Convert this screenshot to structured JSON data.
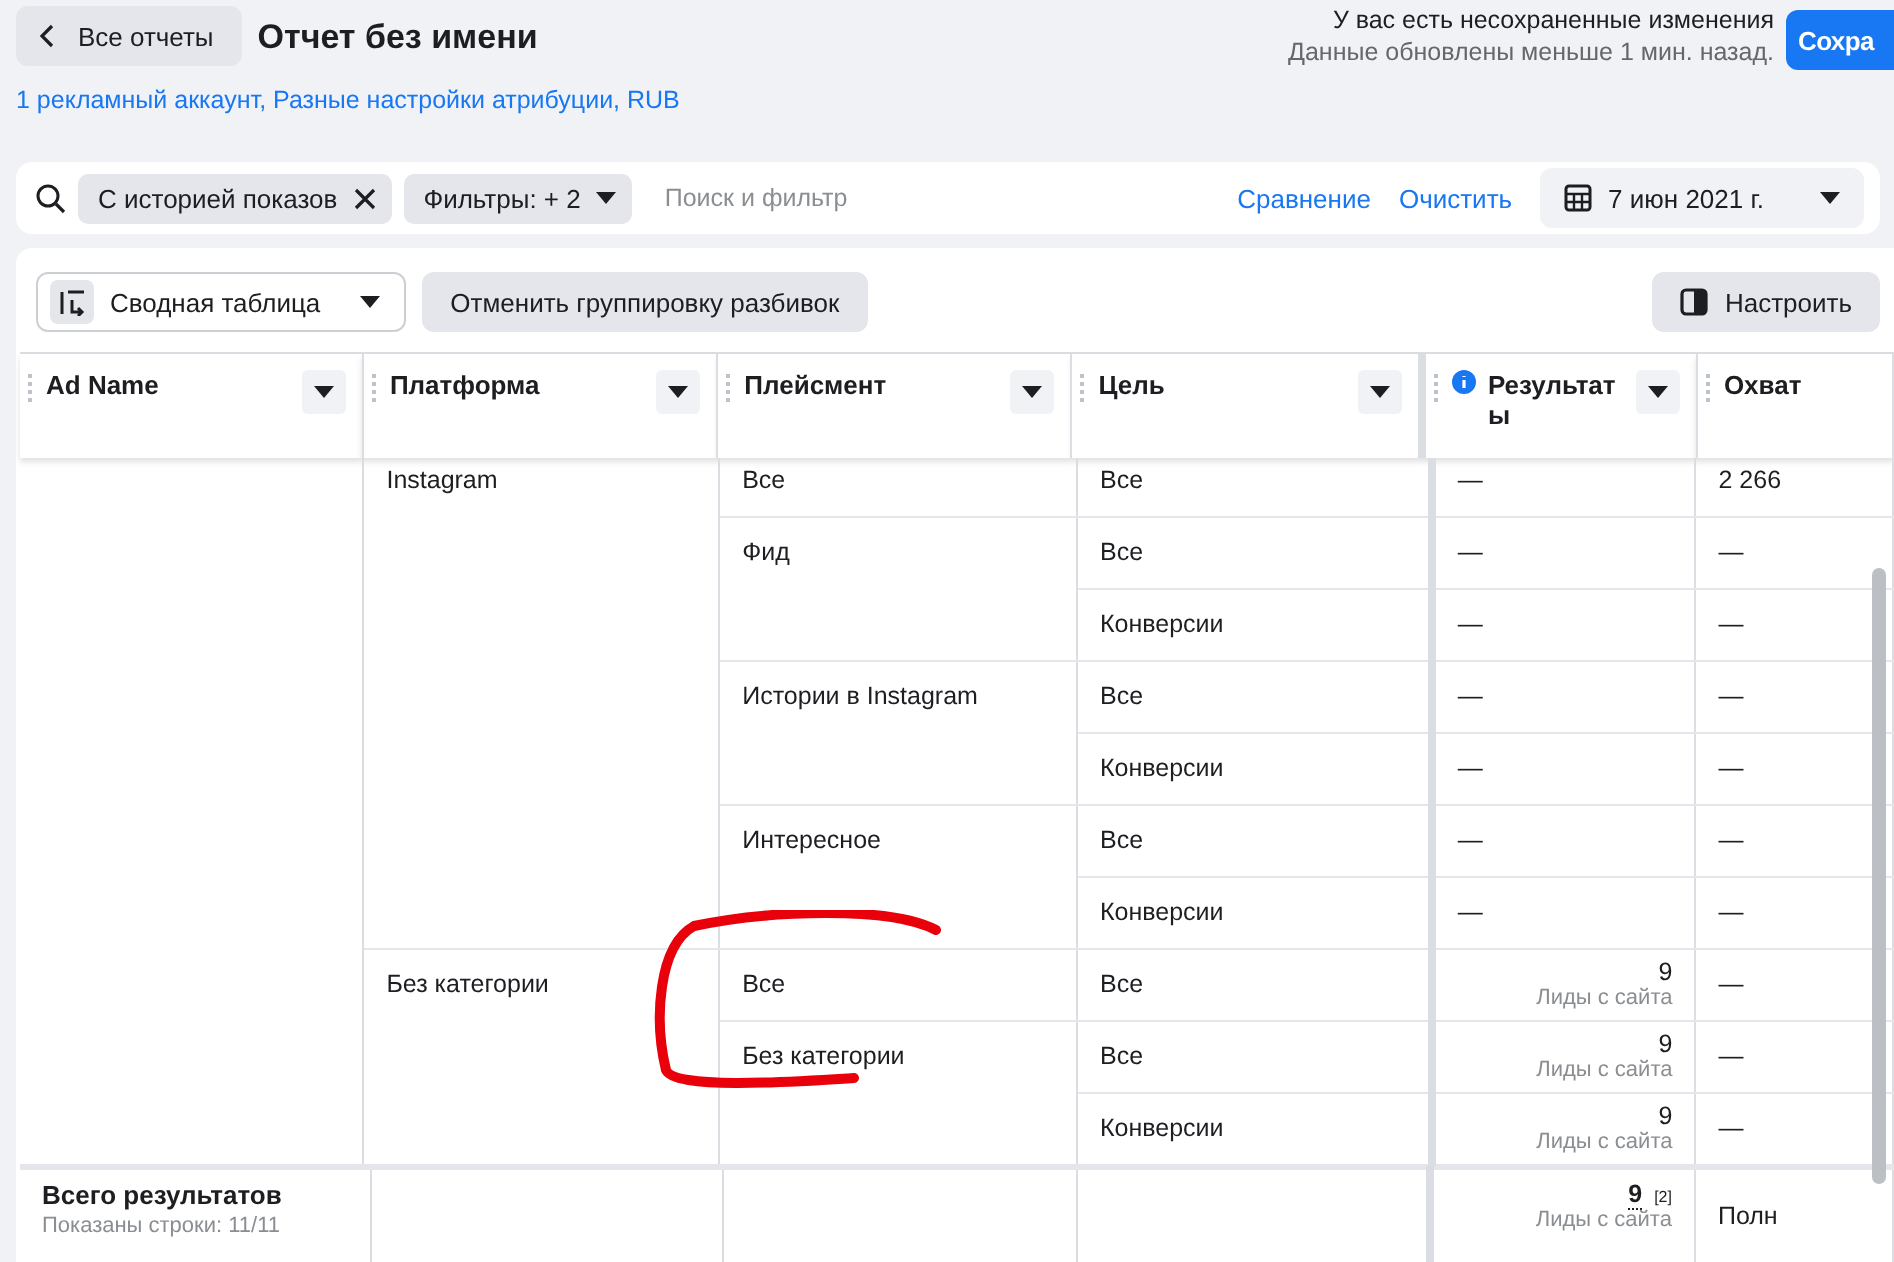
{
  "header": {
    "back_button": "Все отчеты",
    "title": "Отчет без имени",
    "unsaved_notice": "У вас есть несохраненные изменения",
    "updated_notice": "Данные обновлены меньше 1 мин. назад.",
    "save_button": "Сохра",
    "subtitle_link": "1 рекламный аккаунт, Разные настройки атрибуции, RUB"
  },
  "filter_bar": {
    "chips": [
      {
        "label": "С историей показов",
        "kind": "removable"
      },
      {
        "label": "Фильтры: + 2",
        "kind": "dropdown"
      }
    ],
    "placeholder": "Поиск и фильтр",
    "links": [
      "Сравнение",
      "Очистить"
    ],
    "date": "7 июн 2021 г."
  },
  "toolbar": {
    "view_select": "Сводная таблица",
    "ungroup_button": "Отменить группировку разбивок",
    "customize_button": "Настроить"
  },
  "table": {
    "columns": [
      {
        "label": "Ad Name",
        "info": false
      },
      {
        "label": "Платформа",
        "info": false
      },
      {
        "label": "Плейсмент",
        "info": false
      },
      {
        "label": "Цель",
        "info": false
      },
      {
        "label": "Результаты",
        "info": true
      },
      {
        "label": "Охват",
        "info": false
      }
    ],
    "platforms": [
      {
        "name": "Instagram",
        "placements": [
          {
            "name": "Все",
            "goals": [
              {
                "name": "Все",
                "result": "—",
                "reach": "2 266"
              }
            ]
          },
          {
            "name": "Фид",
            "goals": [
              {
                "name": "Все",
                "result": "—",
                "reach": "—"
              },
              {
                "name": "Конверсии",
                "result": "—",
                "reach": "—"
              }
            ]
          },
          {
            "name": "Истории в Instagram",
            "goals": [
              {
                "name": "Все",
                "result": "—",
                "reach": "—"
              },
              {
                "name": "Конверсии",
                "result": "—",
                "reach": "—"
              }
            ]
          },
          {
            "name": "Интересное",
            "goals": [
              {
                "name": "Все",
                "result": "—",
                "reach": "—"
              },
              {
                "name": "Конверсии",
                "result": "—",
                "reach": "—"
              }
            ]
          }
        ]
      },
      {
        "name": "Без категории",
        "placements": [
          {
            "name": "Все",
            "goals": [
              {
                "name": "Все",
                "result": "9",
                "result_sub": "Лиды с сайта",
                "reach": "—"
              }
            ]
          },
          {
            "name": "Без категории",
            "goals": [
              {
                "name": "Все",
                "result": "9",
                "result_sub": "Лиды с сайта",
                "reach": "—"
              },
              {
                "name": "Конверсии",
                "result": "9",
                "result_sub": "Лиды с сайта",
                "reach": "—"
              }
            ]
          }
        ]
      }
    ],
    "total": {
      "label": "Всего результатов",
      "sub": "Показаны строки: 11/11",
      "result": "9",
      "result_note": "[2]",
      "result_sub": "Лиды с сайта",
      "reach": "Полн"
    }
  }
}
